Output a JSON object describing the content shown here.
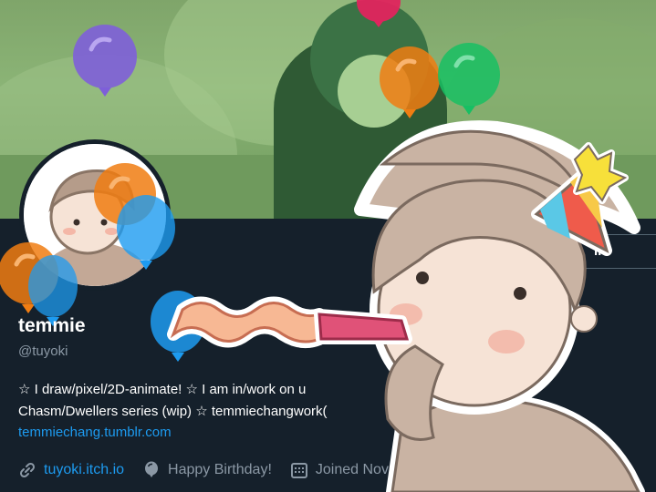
{
  "profile": {
    "display_name": "temmie",
    "handle": "@tuyoki",
    "bio_line_1": "☆ I draw/pixel/2D-animate! ☆ I am in/work on u",
    "bio_line_2": "Chasm/Dwellers series (wip) ☆ temmiechangwork(",
    "bio_link": "temmiechang.tumblr.com",
    "website": "tuyoki.itch.io",
    "birthday": "Happy Birthday!",
    "joined": "Joined Nov",
    "edit_button_label": "ile"
  },
  "icons": {
    "website": "link-icon",
    "birthday": "balloon-icon",
    "joined": "calendar-icon"
  },
  "colors": {
    "background": "#15202b",
    "link": "#1d9bf0",
    "secondary_text": "#8b98a5",
    "balloon_purple": "#7e5fd9",
    "balloon_orange": "#f07d12",
    "balloon_blue": "#1d9bf0",
    "balloon_green": "#17bf63",
    "balloon_pink": "#e0245e"
  }
}
